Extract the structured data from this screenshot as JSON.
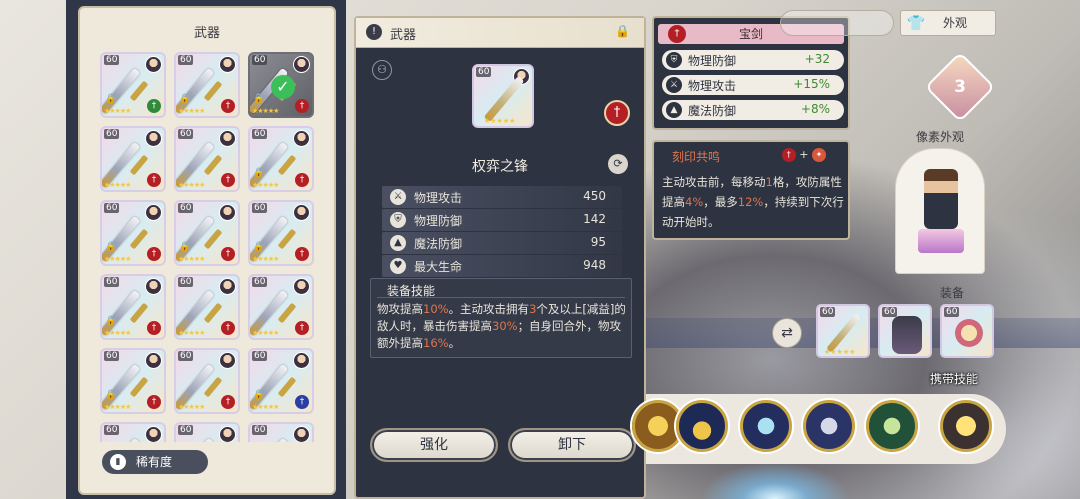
{
  "left_panel": {
    "title": "武器",
    "rarity_button": "稀有度",
    "rarity_icon": "bar-chart-icon",
    "items": [
      {
        "level": "60",
        "stars": "★★★★★",
        "badge": "green",
        "lock": true
      },
      {
        "level": "60",
        "stars": "★★★★★",
        "badge": "red",
        "lock": true
      },
      {
        "level": "60",
        "stars": "★★★★★",
        "badge": "red",
        "lock": true,
        "selected": true
      },
      {
        "level": "60",
        "stars": "★★★★★",
        "badge": "red",
        "lock": false
      },
      {
        "level": "60",
        "stars": "★★★★★",
        "badge": "red",
        "lock": false
      },
      {
        "level": "60",
        "stars": "★★★★★",
        "badge": "red",
        "lock": true
      },
      {
        "level": "60",
        "stars": "★★★★★",
        "badge": "red",
        "lock": true
      },
      {
        "level": "60",
        "stars": "★★★★★",
        "badge": "red",
        "lock": true
      },
      {
        "level": "60",
        "stars": "★★★★★",
        "badge": "red",
        "lock": true
      },
      {
        "level": "60",
        "stars": "★★★★★",
        "badge": "red",
        "lock": true
      },
      {
        "level": "60",
        "stars": "★★★★★",
        "badge": "red",
        "lock": false
      },
      {
        "level": "60",
        "stars": "★★★★★",
        "badge": "red",
        "lock": false
      },
      {
        "level": "60",
        "stars": "★★★★★",
        "badge": "red",
        "lock": true
      },
      {
        "level": "60",
        "stars": "★★★★★",
        "badge": "red",
        "lock": false
      },
      {
        "level": "60",
        "stars": "★★★★★",
        "badge": "blue",
        "lock": true
      },
      {
        "level": "60",
        "stars": "★★★★★",
        "badge": "red",
        "lock": false
      },
      {
        "level": "60",
        "stars": "★★★★★",
        "badge": "red",
        "lock": false
      },
      {
        "level": "60",
        "stars": "★★★★★",
        "badge": "red",
        "lock": false
      }
    ]
  },
  "center": {
    "header_title": "武器",
    "item_level": "60",
    "item_stars": "★★★★★",
    "weapon_name": "权弈之锋",
    "stats": [
      {
        "icon": "sword-icon",
        "glyph": "⚔",
        "label": "物理攻击",
        "value": "450"
      },
      {
        "icon": "shield-icon",
        "glyph": "⛨",
        "label": "物理防御",
        "value": "142"
      },
      {
        "icon": "wizard-hat-icon",
        "glyph": "▲",
        "label": "魔法防御",
        "value": "95"
      },
      {
        "icon": "heart-icon",
        "glyph": "♥",
        "label": "最大生命",
        "value": "948"
      }
    ],
    "skill_title": "装备技能",
    "skill_desc": [
      {
        "t": "物攻提高",
        "h": false
      },
      {
        "t": "10%",
        "h": true
      },
      {
        "t": "。主动攻击拥有",
        "h": false
      },
      {
        "t": "3",
        "h": true
      },
      {
        "t": "个及以上[减益]的敌人时，暴击伤害提高",
        "h": false
      },
      {
        "t": "30%",
        "h": true
      },
      {
        "t": "；自身回合外，物攻额外提高",
        "h": false
      },
      {
        "t": "16%",
        "h": true
      },
      {
        "t": "。",
        "h": false
      }
    ],
    "btn_enhance": "强化",
    "btn_unequip": "卸下"
  },
  "tooltip_stats": {
    "title": "宝剑",
    "rows": [
      {
        "icon": "shield-icon",
        "glyph": "⛨",
        "label": "物理防御",
        "value": "+32"
      },
      {
        "icon": "sword-icon",
        "glyph": "⚔",
        "label": "物理攻击",
        "value": "+15%"
      },
      {
        "icon": "wizard-hat-icon",
        "glyph": "▲",
        "label": "魔法防御",
        "value": "+8%"
      }
    ]
  },
  "tooltip_imprint": {
    "title": "刻印共鸣",
    "plus": "+",
    "desc": [
      {
        "t": "主动攻击前，每移动",
        "h": false
      },
      {
        "t": "1",
        "h": true
      },
      {
        "t": "格，攻防属性提高",
        "h": false
      },
      {
        "t": "4%",
        "h": true
      },
      {
        "t": "，最多",
        "h": false
      },
      {
        "t": "12%",
        "h": true
      },
      {
        "t": "，持续到下次行动开始时。",
        "h": false
      }
    ]
  },
  "right": {
    "tab_appearance": "外观",
    "gem_number": "3",
    "pixel_label": "像素外观",
    "equip_label": "装备",
    "carry_label": "携带技能",
    "equip_levels": [
      "60",
      "60",
      "60"
    ],
    "equip_stars": [
      "★★★★★",
      "",
      ""
    ]
  },
  "colors": {
    "highlight": "#e0744b",
    "bonus_green": "#3e8a2f",
    "panel_dark": "#2e3341",
    "panel_light": "#efe9dc",
    "weapon_badge_red": "#b41f25"
  }
}
